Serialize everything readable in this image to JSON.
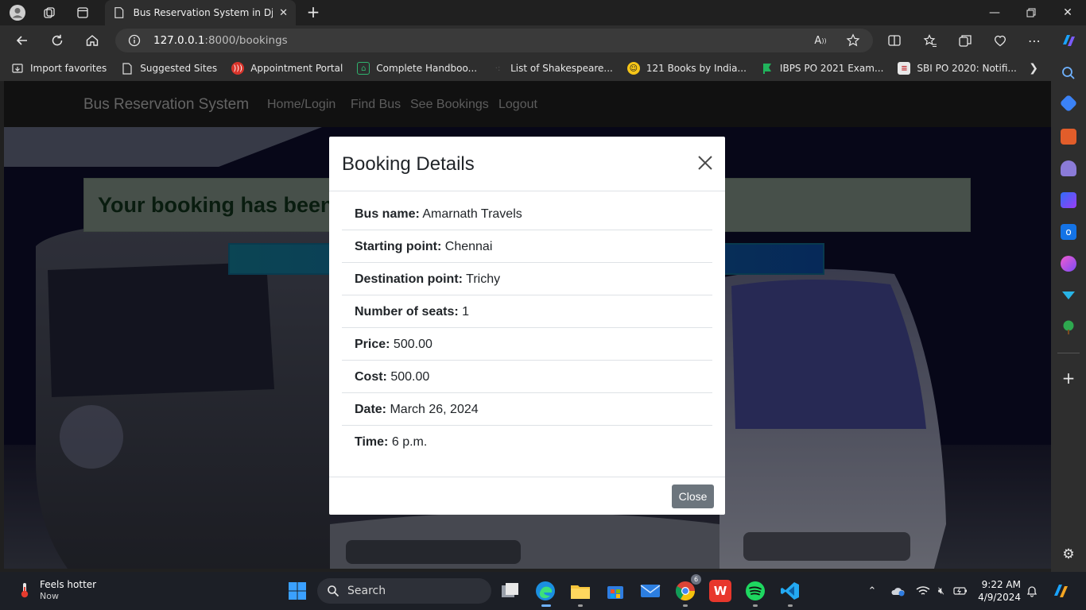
{
  "browser": {
    "tab_title": "Bus Reservation System in Django",
    "url_host": "127.0.0.1",
    "url_rest": ":8000/bookings",
    "favorites": [
      {
        "label": "Import favorites",
        "icon": "import-icon"
      },
      {
        "label": "Suggested Sites",
        "icon": "page-icon"
      },
      {
        "label": "Appointment Portal",
        "icon": "wifi-logo-icon"
      },
      {
        "label": "Complete Handboo...",
        "icon": "book-icon"
      },
      {
        "label": "List of Shakespeare...",
        "icon": "dots-icon"
      },
      {
        "label": "121 Books by India...",
        "icon": "smile-icon"
      },
      {
        "label": "IBPS PO 2021 Exam...",
        "icon": "flag-icon"
      },
      {
        "label": "SBI PO 2020: Notifi...",
        "icon": "doc-icon"
      }
    ]
  },
  "site": {
    "brand": "Bus Reservation System",
    "nav": [
      "Home/Login",
      "Find Bus",
      "See Bookings",
      "Logout"
    ],
    "alert_text": "Your booking has been"
  },
  "modal": {
    "title": "Booking Details",
    "rows": [
      {
        "label": "Bus name:",
        "value": "Amarnath Travels"
      },
      {
        "label": "Starting point:",
        "value": "Chennai"
      },
      {
        "label": "Destination point:",
        "value": "Trichy"
      },
      {
        "label": "Number of seats:",
        "value": "1"
      },
      {
        "label": "Price:",
        "value": "500.00"
      },
      {
        "label": "Cost:",
        "value": "500.00"
      },
      {
        "label": "Date:",
        "value": "March 26, 2024"
      },
      {
        "label": "Time:",
        "value": "6 p.m."
      }
    ],
    "close_label": "Close"
  },
  "taskbar": {
    "weather_title": "Feels hotter",
    "weather_sub": "Now",
    "search_label": "Search",
    "time": "9:22 AM",
    "date": "4/9/2024",
    "chrome_badge": "6"
  },
  "colors": {
    "modal_close_btn": "#6c757d",
    "alert_bg": "#6e7c72",
    "blue_bar": "#0a3f89"
  }
}
